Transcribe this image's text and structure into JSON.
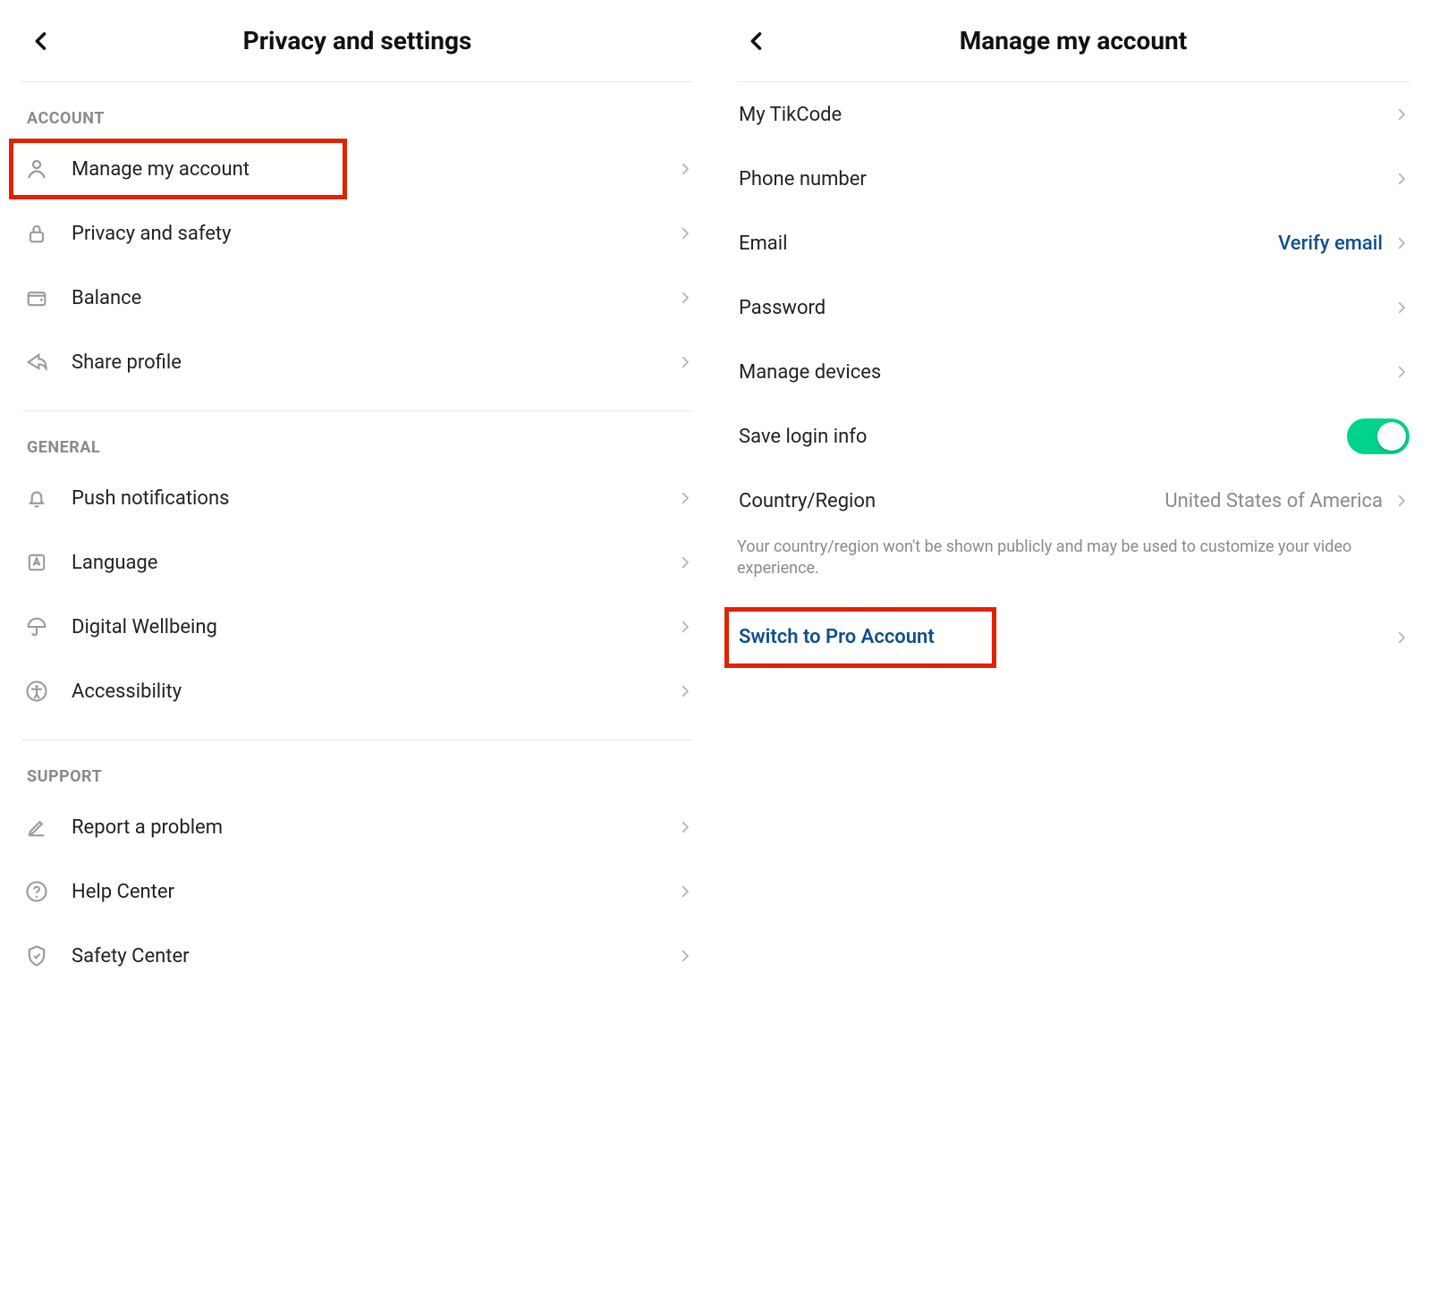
{
  "left": {
    "title": "Privacy and settings",
    "sections": {
      "account": {
        "label": "ACCOUNT",
        "items": {
          "manage": "Manage my account",
          "privacy": "Privacy and safety",
          "balance": "Balance",
          "share": "Share profile"
        }
      },
      "general": {
        "label": "GENERAL",
        "items": {
          "push": "Push notifications",
          "language": "Language",
          "wellbeing": "Digital Wellbeing",
          "accessibility": "Accessibility"
        }
      },
      "support": {
        "label": "SUPPORT",
        "items": {
          "report": "Report a problem",
          "help": "Help Center",
          "safety": "Safety Center"
        }
      }
    }
  },
  "right": {
    "title": "Manage my account",
    "items": {
      "tikcode": "My TikCode",
      "phone": "Phone number",
      "email": "Email",
      "email_action": "Verify email",
      "password": "Password",
      "devices": "Manage devices",
      "savelogin": "Save login info",
      "country": "Country/Region",
      "country_value": "United States of America",
      "country_note": "Your country/region won't be shown publicly and may be used to customize your video experience.",
      "switchpro": "Switch to Pro Account"
    }
  },
  "colors": {
    "highlight": "#e12200",
    "link": "#0f4f8f",
    "toggle_on": "#00d48a"
  }
}
